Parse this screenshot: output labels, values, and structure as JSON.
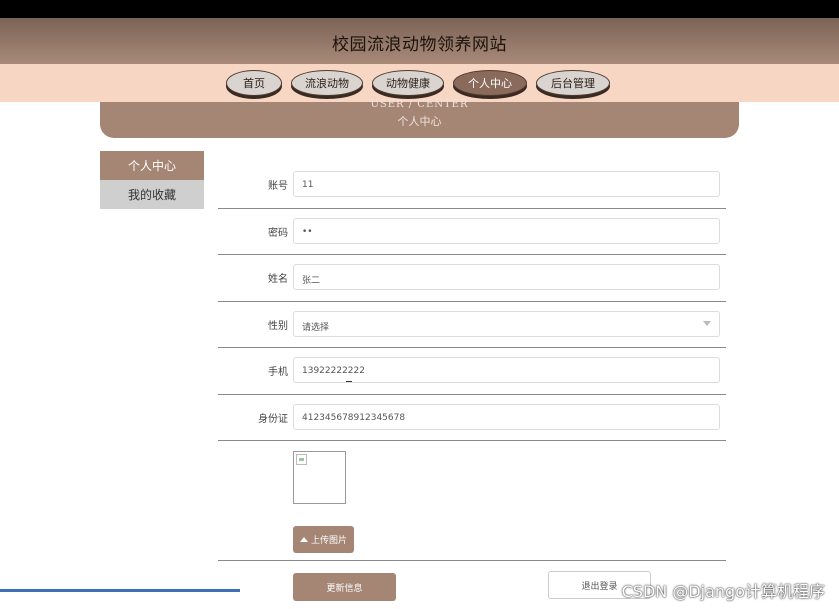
{
  "site": {
    "title": "校园流浪动物领养网站"
  },
  "nav": {
    "items": [
      {
        "label": "首页",
        "active": false
      },
      {
        "label": "流浪动物",
        "active": false
      },
      {
        "label": "动物健康",
        "active": false
      },
      {
        "label": "个人中心",
        "active": true
      },
      {
        "label": "后台管理",
        "active": false
      }
    ]
  },
  "banner": {
    "en": "USER / CENTER",
    "cn": "个人中心"
  },
  "sidebar": {
    "items": [
      {
        "label": "个人中心",
        "active": true
      },
      {
        "label": "我的收藏",
        "active": false
      }
    ]
  },
  "form": {
    "fields": [
      {
        "label": "账号",
        "value": "11"
      },
      {
        "label": "密码",
        "value": "••"
      },
      {
        "label": "姓名",
        "value": "张二"
      },
      {
        "label": "性别",
        "value": "请选择"
      },
      {
        "label": "手机",
        "value": "13922222222"
      },
      {
        "label": "身份证",
        "value": "412345678912345678"
      }
    ],
    "upload_label": "上传图片",
    "submit_label": "更新信息",
    "logout_label": "退出登录"
  },
  "watermark": "CSDN @Django计算机程序"
}
